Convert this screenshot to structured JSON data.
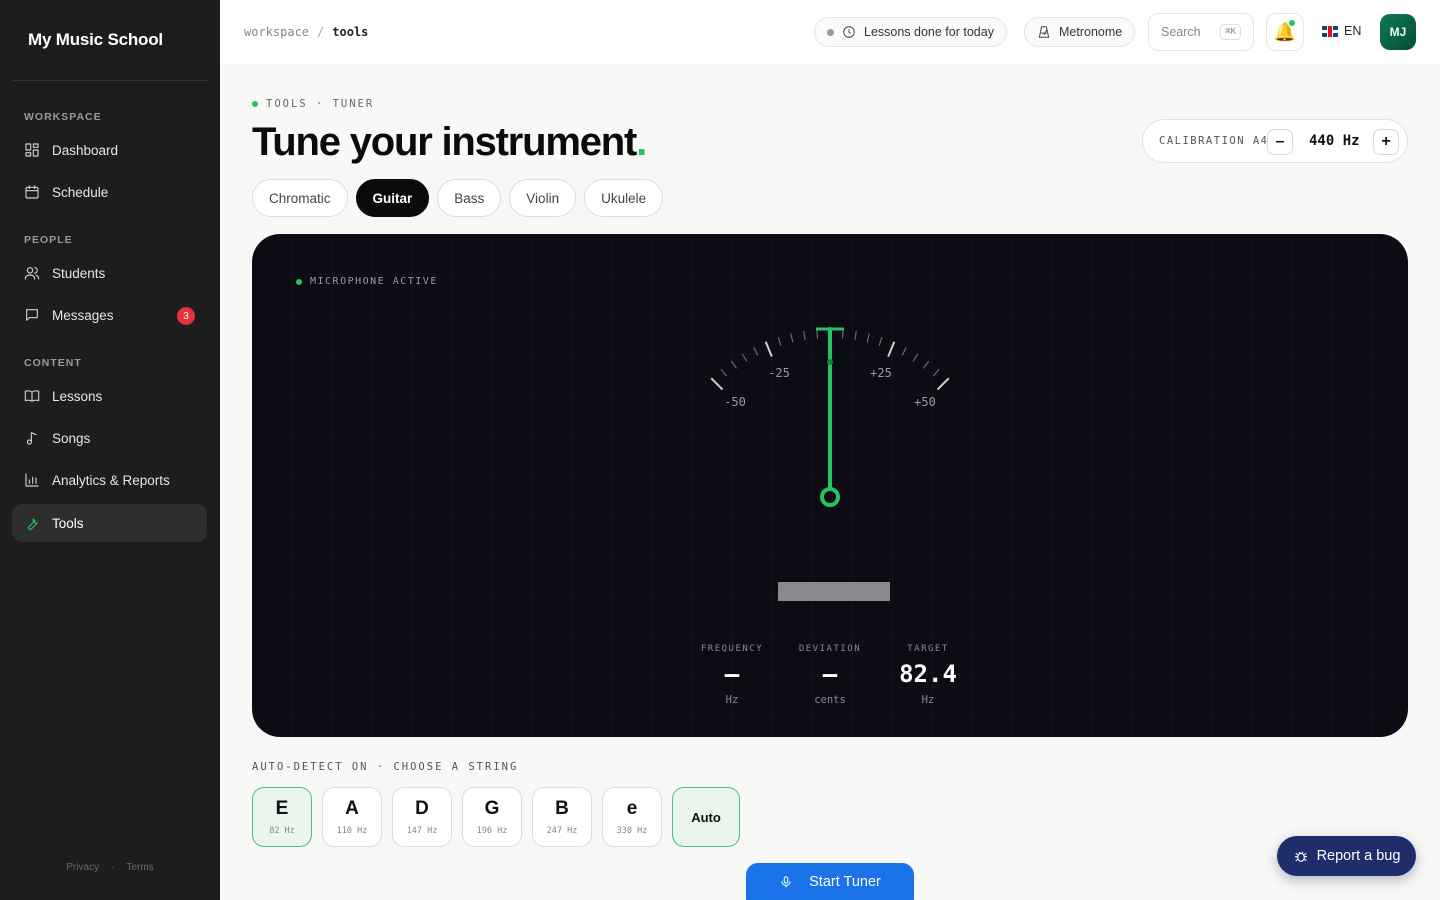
{
  "app": {
    "brand": "My Music School"
  },
  "sidebar": {
    "sections": [
      "WORKSPACE",
      "PEOPLE",
      "CONTENT"
    ],
    "items": [
      {
        "label": "Dashboard",
        "icon": "dashboard-icon"
      },
      {
        "label": "Schedule",
        "icon": "calendar-icon"
      },
      {
        "label": "Students",
        "icon": "users-icon"
      },
      {
        "label": "Messages",
        "icon": "message-icon",
        "badge": "3"
      },
      {
        "label": "Lessons",
        "icon": "book-icon"
      },
      {
        "label": "Songs",
        "icon": "music-note-icon"
      },
      {
        "label": "Analytics & Reports",
        "icon": "bar-chart-icon"
      },
      {
        "label": "Tools",
        "icon": "wrench-icon",
        "active": true
      }
    ],
    "footer": {
      "privacy": "Privacy",
      "sep": "·",
      "terms": "Terms"
    }
  },
  "topbar": {
    "breadcrumb": {
      "root": "workspace",
      "sep": "/",
      "current": "tools"
    },
    "lessons_pill": "Lessons done for today",
    "metronome": "Metronome",
    "search_placeholder": "Search",
    "search_kbd": "⌘K",
    "language": "EN",
    "avatar_initials": "MJ"
  },
  "header": {
    "eyebrow": "TOOLS · TUNER",
    "title": "Tune your instrument",
    "title_dot": ".",
    "calibration_label": "CALIBRATION A4",
    "calibration_value": "440 Hz",
    "minus": "–",
    "plus": "+"
  },
  "tabs": [
    {
      "label": "Chromatic"
    },
    {
      "label": "Guitar",
      "active": true
    },
    {
      "label": "Bass"
    },
    {
      "label": "Violin"
    },
    {
      "label": "Ukulele"
    }
  ],
  "tuner": {
    "mic_status": "MICROPHONE ACTIVE",
    "scale_labels": {
      "m50": "-50",
      "m25": "-25",
      "p25": "+25",
      "p50": "+50"
    },
    "needle_cents": 0,
    "frequency": {
      "label": "FREQUENCY",
      "value": "–",
      "unit": "Hz"
    },
    "deviation": {
      "label": "DEVIATION",
      "value": "–",
      "unit": "cents"
    },
    "target": {
      "label": "TARGET",
      "value": "82.4",
      "unit": "Hz"
    },
    "accent": "#22c55e"
  },
  "strings": {
    "label": "AUTO-DETECT ON · CHOOSE A STRING",
    "items": [
      {
        "note": "E",
        "hz": "82 Hz",
        "selected": true
      },
      {
        "note": "A",
        "hz": "110 Hz"
      },
      {
        "note": "D",
        "hz": "147 Hz"
      },
      {
        "note": "G",
        "hz": "196 Hz"
      },
      {
        "note": "B",
        "hz": "247 Hz"
      },
      {
        "note": "e",
        "hz": "330 Hz"
      }
    ],
    "auto": "Auto"
  },
  "actions": {
    "start": "Start Tuner",
    "report_bug": "Report a bug"
  }
}
